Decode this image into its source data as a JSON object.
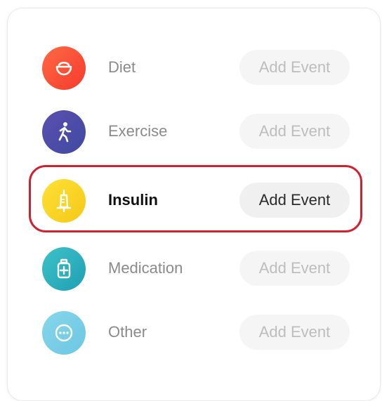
{
  "events": [
    {
      "key": "diet",
      "label": "Diet",
      "button_label": "Add Event",
      "icon": "bowl-icon",
      "active": false
    },
    {
      "key": "exercise",
      "label": "Exercise",
      "button_label": "Add Event",
      "icon": "running-person-icon",
      "active": false
    },
    {
      "key": "insulin",
      "label": "Insulin",
      "button_label": "Add Event",
      "icon": "insulin-syringe-icon",
      "active": true
    },
    {
      "key": "medication",
      "label": "Medication",
      "button_label": "Add Event",
      "icon": "medicine-bottle-icon",
      "active": false
    },
    {
      "key": "other",
      "label": "Other",
      "button_label": "Add Event",
      "icon": "more-dots-icon",
      "active": false
    }
  ],
  "colors": {
    "diet": "#f5472f",
    "exercise": "#4a4ca8",
    "insulin": "#fbd624",
    "medication": "#2eb0bd",
    "other": "#79cfe6",
    "highlight_border": "#cf2230"
  }
}
